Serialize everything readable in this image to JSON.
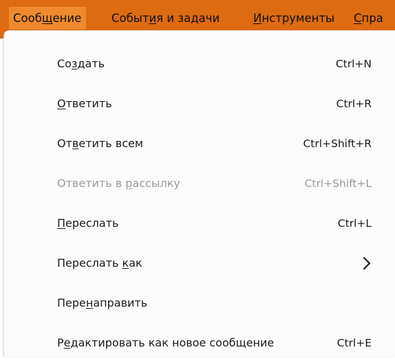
{
  "colors": {
    "menubar_bg": "#dd6b12",
    "menubar_active_bg": "#f08a2f",
    "menu_bg": "#fbfbfb",
    "text": "#1b1b1b",
    "disabled_text": "#9a9a9a"
  },
  "menubar": {
    "items": [
      {
        "label_before": "Сооб",
        "label_underlined": "щ",
        "label_after": "ение",
        "active": true
      },
      {
        "label_before": "Событ",
        "label_underlined": "и",
        "label_after": "я и задачи",
        "active": false
      },
      {
        "label_before": "",
        "label_underlined": "И",
        "label_after": "нструменты",
        "active": false
      },
      {
        "label_before": "",
        "label_underlined": "С",
        "label_after": "пра",
        "active": false
      }
    ]
  },
  "menu": {
    "items": [
      {
        "before": "Со",
        "underlined": "з",
        "after": "дать",
        "shortcut": "Ctrl+N",
        "disabled": false,
        "submenu": false
      },
      {
        "before": "",
        "underlined": "О",
        "after": "тветить",
        "shortcut": "Ctrl+R",
        "disabled": false,
        "submenu": false
      },
      {
        "before": "От",
        "underlined": "в",
        "after": "етить всем",
        "shortcut": "Ctrl+Shift+R",
        "disabled": false,
        "submenu": false
      },
      {
        "before": "Ответить в ",
        "underlined": "р",
        "after": "ассылку",
        "shortcut": "Ctrl+Shift+L",
        "disabled": true,
        "submenu": false
      },
      {
        "before": "",
        "underlined": "П",
        "after": "ереслать",
        "shortcut": "Ctrl+L",
        "disabled": false,
        "submenu": false
      },
      {
        "before": "Переслать ",
        "underlined": "к",
        "after": "ак",
        "shortcut": "",
        "disabled": false,
        "submenu": true,
        "submenu_icon": "chevron-right-icon"
      },
      {
        "before": "Пере",
        "underlined": "н",
        "after": "аправить",
        "shortcut": "",
        "disabled": false,
        "submenu": false
      },
      {
        "before": "Р",
        "underlined": "е",
        "after": "дактировать как новое сообщение",
        "shortcut": "Ctrl+E",
        "disabled": false,
        "submenu": false
      }
    ]
  }
}
